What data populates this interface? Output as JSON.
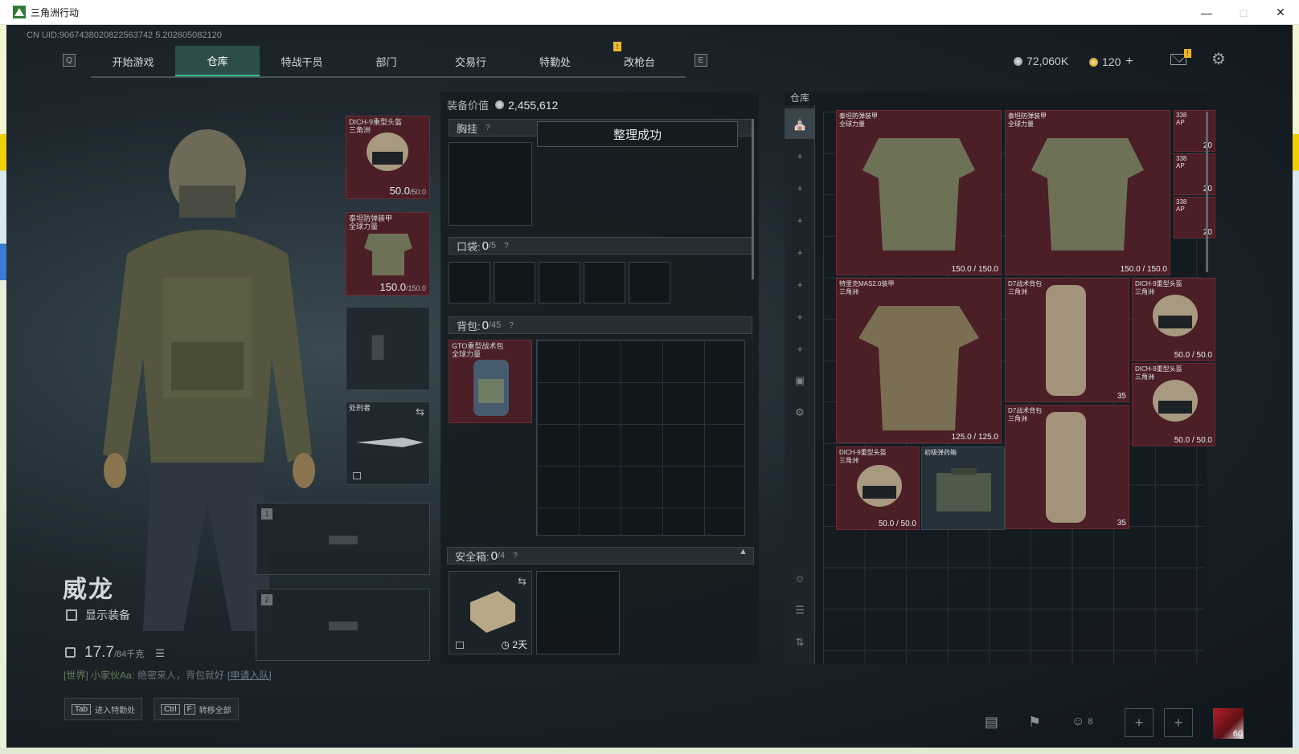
{
  "window": {
    "title": "三角洲行动"
  },
  "uid": "CN UID:9067438020822563742 5.202605082120",
  "nav": {
    "key_left": "Q",
    "key_right": "E",
    "items": [
      "开始游戏",
      "仓库",
      "特战干员",
      "部门",
      "交易行",
      "特勤处",
      "改枪台"
    ],
    "active_index": 1,
    "badge": "!"
  },
  "currency": {
    "silver": "72,060K",
    "gold": "120",
    "gold_plus": "+",
    "mail_badge": "!"
  },
  "operator": {
    "name": "威龙",
    "show_gear_label": "显示装备",
    "weight_value": "17.7",
    "weight_cap": "/84千克"
  },
  "chat": {
    "channel": "[世界]",
    "sender": "小家伙Aa:",
    "message": "绝密来人，背包就好",
    "link": "[申请入队]"
  },
  "hints": [
    {
      "keys": [
        "Tab"
      ],
      "label": "进入特勤处"
    },
    {
      "keys": [
        "Ctrl",
        "F"
      ],
      "label": "转移全部"
    }
  ],
  "equip": {
    "helmet": {
      "name": "DICH-9重型头盔",
      "sub": "三角洲",
      "dur": "50.0",
      "max": "/50.0"
    },
    "armor": {
      "name": "泰坦防弹装甲",
      "sub": "全球力量",
      "dur": "150.0",
      "max": "/150.0"
    },
    "melee": {
      "name": "处刑者"
    },
    "weapon_slot_1": "1",
    "weapon_slot_2": "2"
  },
  "loadout": {
    "value_label": "装备价值",
    "value": "2,455,612",
    "chest_label": "胸挂",
    "toast": "整理成功",
    "pocket_label": "口袋:",
    "pocket_count": "0",
    "pocket_cap": "/5",
    "backpack_label": "背包:",
    "backpack_count": "0",
    "backpack_cap": "/45",
    "backpack_item": {
      "name": "GTO重型战术包",
      "sub": "全球力量"
    },
    "safe_label": "安全箱:",
    "safe_count": "0",
    "safe_cap": "/4",
    "safe_time": "2天",
    "help": "?"
  },
  "warehouse": {
    "title": "仓库",
    "items": [
      {
        "name": "泰坦防弹装甲",
        "sub": "全球力量",
        "dur": "150.0 / 150.0"
      },
      {
        "name": "泰坦防弹装甲",
        "sub": "全球力量",
        "dur": "150.0 / 150.0"
      },
      {
        "name": "特里克MAS2.0装甲",
        "sub": "三角洲",
        "dur": "125.0 / 125.0"
      },
      {
        "name": "D7战术背包",
        "sub": "三角洲",
        "cnt": "35"
      },
      {
        "name": "DICH-9重型头盔",
        "sub": "三角洲",
        "dur": "50.0 / 50.0"
      },
      {
        "name": "DICH-9重型头盔",
        "sub": "三角洲",
        "dur": "50.0 / 50.0"
      },
      {
        "name": "D7战术背包",
        "sub": "三角洲",
        "cnt": "35"
      },
      {
        "name": "DICH-9重型头盔",
        "sub": "三角洲",
        "dur": "50.0 / 50.0"
      },
      {
        "name": "初级弹药箱",
        "sub": ""
      }
    ],
    "ammo": [
      {
        "caliber": "338",
        "type": "AP",
        "cnt": "20"
      },
      {
        "caliber": "338",
        "type": "AP",
        "cnt": "20"
      },
      {
        "caliber": "338",
        "type": "AP",
        "cnt": "20"
      }
    ]
  },
  "bottom": {
    "squad_count": "8",
    "avatar_level": "60"
  }
}
